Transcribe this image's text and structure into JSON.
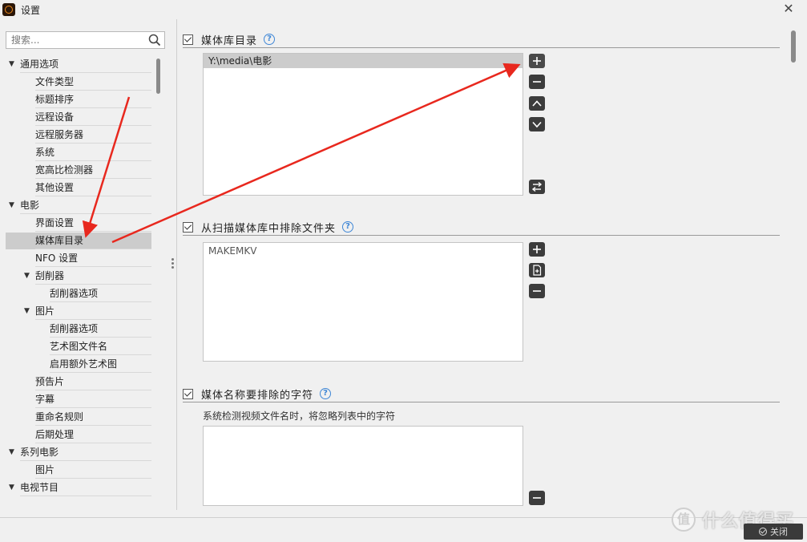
{
  "window": {
    "title": "设置",
    "close_symbol": "✕"
  },
  "sidebar": {
    "search_placeholder": "搜索...",
    "items": [
      {
        "label": "通用选项",
        "level": 0,
        "expanded": true
      },
      {
        "label": "文件类型",
        "level": 1
      },
      {
        "label": "标题排序",
        "level": 1
      },
      {
        "label": "远程设备",
        "level": 1
      },
      {
        "label": "远程服务器",
        "level": 1
      },
      {
        "label": "系统",
        "level": 1
      },
      {
        "label": "宽高比检测器",
        "level": 1
      },
      {
        "label": "其他设置",
        "level": 1
      },
      {
        "label": "电影",
        "level": 0,
        "expanded": true
      },
      {
        "label": "界面设置",
        "level": 1
      },
      {
        "label": "媒体库目录",
        "level": 1,
        "selected": true
      },
      {
        "label": "NFO 设置",
        "level": 1
      },
      {
        "label": "刮削器",
        "level": 1,
        "expanded": true
      },
      {
        "label": "刮削器选项",
        "level": 2
      },
      {
        "label": "图片",
        "level": 1,
        "expanded": true
      },
      {
        "label": "刮削器选项",
        "level": 2
      },
      {
        "label": "艺术图文件名",
        "level": 2
      },
      {
        "label": "启用额外艺术图",
        "level": 2
      },
      {
        "label": "预告片",
        "level": 1
      },
      {
        "label": "字幕",
        "level": 1
      },
      {
        "label": "重命名规则",
        "level": 1
      },
      {
        "label": "后期处理",
        "level": 1
      },
      {
        "label": "系列电影",
        "level": 0,
        "expanded": true
      },
      {
        "label": "图片",
        "level": 1
      },
      {
        "label": "电视节目",
        "level": 0,
        "expanded": true
      }
    ]
  },
  "sections": {
    "library": {
      "title": "媒体库目录",
      "help": "?",
      "entries": [
        "Y:\\media\\电影"
      ]
    },
    "exclude": {
      "title": "从扫描媒体库中排除文件夹",
      "help": "?",
      "entries": [
        "MAKEMKV"
      ]
    },
    "strip": {
      "title": "媒体名称要排除的字符",
      "help": "?",
      "description": "系统检测视频文件名时，将忽略列表中的字符",
      "entries": []
    }
  },
  "footer": {
    "ok_label": "关闭"
  },
  "watermark": {
    "logo": "值",
    "text": "什么值得买"
  },
  "colors": {
    "annotation_arrow": "#e8281e",
    "button_dark": "#3c3c3c",
    "help_blue": "#3e86d6"
  }
}
